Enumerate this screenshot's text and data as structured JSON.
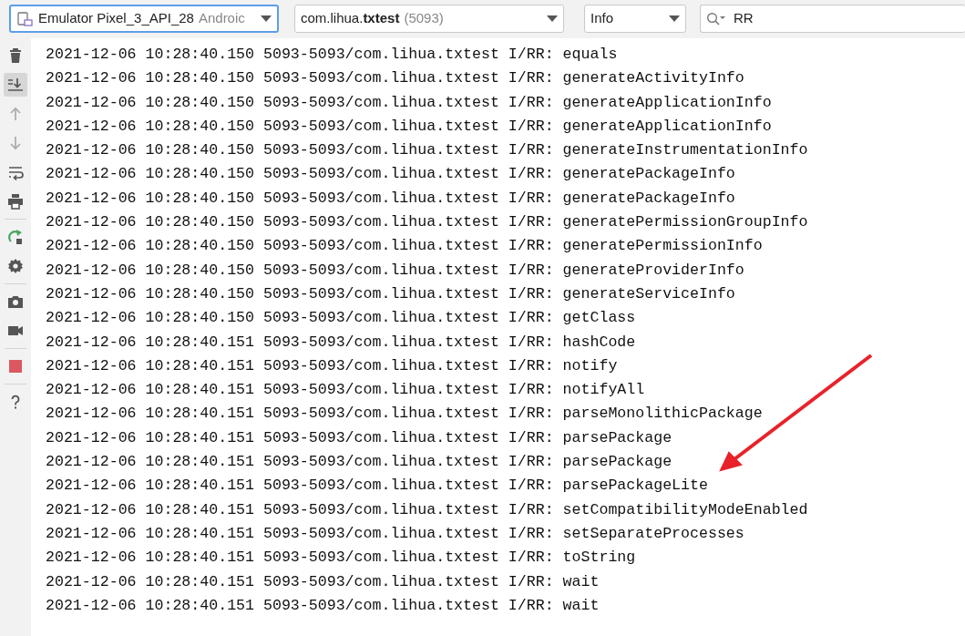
{
  "toolbar": {
    "device": {
      "name": "Emulator Pixel_3_API_28",
      "detail": "Androic",
      "focused": true
    },
    "process": {
      "name": "com.lihua.**txtest**",
      "pid": "(5093)"
    },
    "level": "Info",
    "search": {
      "value": "RR"
    }
  },
  "tools": [
    {
      "kind": "clear",
      "selected": false,
      "disabled": false
    },
    {
      "kind": "scroll-end",
      "selected": true,
      "disabled": false
    },
    {
      "kind": "up",
      "selected": false,
      "disabled": true
    },
    {
      "kind": "down",
      "selected": false,
      "disabled": true
    },
    {
      "kind": "wrap",
      "selected": false,
      "disabled": false
    },
    {
      "kind": "print",
      "selected": false,
      "disabled": false
    },
    {
      "kind": "separator"
    },
    {
      "kind": "restart",
      "selected": false,
      "disabled": false
    },
    {
      "kind": "settings",
      "selected": false,
      "disabled": false
    },
    {
      "kind": "separator"
    },
    {
      "kind": "camera",
      "selected": false,
      "disabled": false
    },
    {
      "kind": "video",
      "selected": false,
      "disabled": false
    },
    {
      "kind": "separator"
    },
    {
      "kind": "stop",
      "selected": false,
      "disabled": false
    },
    {
      "kind": "separator"
    },
    {
      "kind": "help",
      "selected": false,
      "disabled": false
    }
  ],
  "log_lines": [
    "2021-12-06 10:28:40.150 5093-5093/com.lihua.txtest I/RR: equals",
    "2021-12-06 10:28:40.150 5093-5093/com.lihua.txtest I/RR: generateActivityInfo",
    "2021-12-06 10:28:40.150 5093-5093/com.lihua.txtest I/RR: generateApplicationInfo",
    "2021-12-06 10:28:40.150 5093-5093/com.lihua.txtest I/RR: generateApplicationInfo",
    "2021-12-06 10:28:40.150 5093-5093/com.lihua.txtest I/RR: generateInstrumentationInfo",
    "2021-12-06 10:28:40.150 5093-5093/com.lihua.txtest I/RR: generatePackageInfo",
    "2021-12-06 10:28:40.150 5093-5093/com.lihua.txtest I/RR: generatePackageInfo",
    "2021-12-06 10:28:40.150 5093-5093/com.lihua.txtest I/RR: generatePermissionGroupInfo",
    "2021-12-06 10:28:40.150 5093-5093/com.lihua.txtest I/RR: generatePermissionInfo",
    "2021-12-06 10:28:40.150 5093-5093/com.lihua.txtest I/RR: generateProviderInfo",
    "2021-12-06 10:28:40.150 5093-5093/com.lihua.txtest I/RR: generateServiceInfo",
    "2021-12-06 10:28:40.150 5093-5093/com.lihua.txtest I/RR: getClass",
    "2021-12-06 10:28:40.151 5093-5093/com.lihua.txtest I/RR: hashCode",
    "2021-12-06 10:28:40.151 5093-5093/com.lihua.txtest I/RR: notify",
    "2021-12-06 10:28:40.151 5093-5093/com.lihua.txtest I/RR: notifyAll",
    "2021-12-06 10:28:40.151 5093-5093/com.lihua.txtest I/RR: parseMonolithicPackage",
    "2021-12-06 10:28:40.151 5093-5093/com.lihua.txtest I/RR: parsePackage",
    "2021-12-06 10:28:40.151 5093-5093/com.lihua.txtest I/RR: parsePackage",
    "2021-12-06 10:28:40.151 5093-5093/com.lihua.txtest I/RR: parsePackageLite",
    "2021-12-06 10:28:40.151 5093-5093/com.lihua.txtest I/RR: setCompatibilityModeEnabled",
    "2021-12-06 10:28:40.151 5093-5093/com.lihua.txtest I/RR: setSeparateProcesses",
    "2021-12-06 10:28:40.151 5093-5093/com.lihua.txtest I/RR: toString",
    "2021-12-06 10:28:40.151 5093-5093/com.lihua.txtest I/RR: wait",
    "2021-12-06 10:28:40.151 5093-5093/com.lihua.txtest I/RR: wait"
  ]
}
